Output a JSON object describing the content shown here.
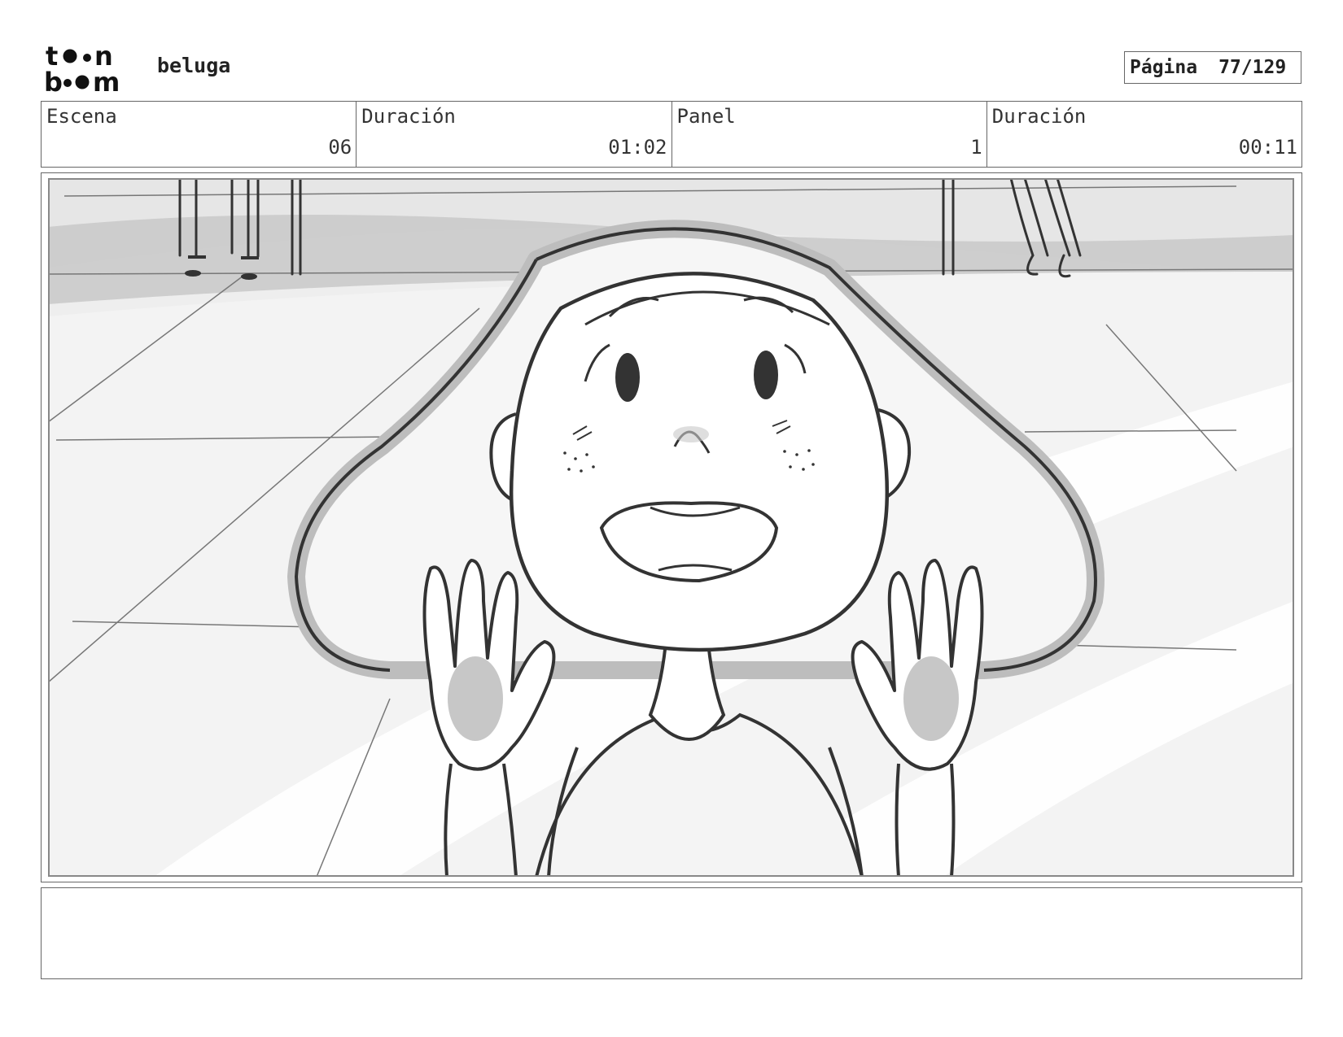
{
  "header": {
    "logo": {
      "alt_name": "toon-boom-logo-icon",
      "line1": "t··n",
      "line2": "b··m"
    },
    "project_name": "beluga",
    "page_label": "Página",
    "page_number": "77/129"
  },
  "info": {
    "scene_label": "Escena",
    "scene_value": "06",
    "scene_duration_label": "Duración",
    "scene_duration_value": "01:02",
    "panel_label": "Panel",
    "panel_value": "1",
    "panel_duration_label": "Duración",
    "panel_duration_value": "00:11"
  },
  "panel": {
    "drawing": "storyboard-sketch-icon",
    "colors": {
      "background": "#efefef",
      "floor": "#f5f5f5",
      "band": "#c9c9c9",
      "ink": "#333333",
      "shade": "#bdbdbd"
    }
  },
  "notes": {
    "text": ""
  }
}
